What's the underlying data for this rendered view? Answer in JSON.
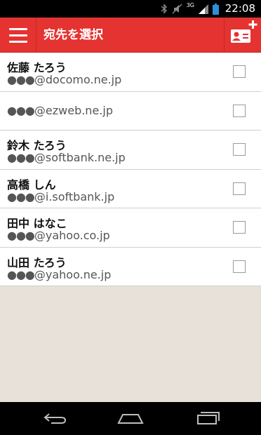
{
  "status_bar": {
    "time": "22:08",
    "network": "3G"
  },
  "app_bar": {
    "menu_icon": "hamburger-menu-icon",
    "title": "宛先を選択",
    "add_icon": "add-contact-card-icon"
  },
  "contacts": [
    {
      "name": "佐藤 たろう",
      "dots": "●●●",
      "domain": "@docomo.ne.jp"
    },
    {
      "name": "",
      "dots": "●●●",
      "domain": "@ezweb.ne.jp"
    },
    {
      "name": "鈴木 たろう",
      "dots": "●●●",
      "domain": "@softbank.ne.jp"
    },
    {
      "name": "高橋 しん",
      "dots": "●●●",
      "domain": "@i.softbank.jp"
    },
    {
      "name": "田中 はなこ",
      "dots": "●●●",
      "domain": "@yahoo.co.jp"
    },
    {
      "name": "山田 たろう",
      "dots": "●●●",
      "domain": "@yahoo.ne.jp"
    }
  ],
  "colors": {
    "accent": "#e43330",
    "background": "#e7e1d9"
  }
}
